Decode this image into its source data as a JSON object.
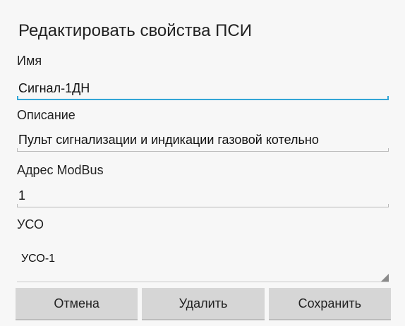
{
  "dialog": {
    "title": "Редактировать свойства ПСИ"
  },
  "fields": {
    "name": {
      "label": "Имя",
      "value": "Сигнал-1ДН"
    },
    "description": {
      "label": "Описание",
      "value": "Пульт сигнализации и индикации газовой котельно"
    },
    "modbus_address": {
      "label": "Адрес ModBus",
      "value": "1"
    },
    "uso": {
      "label": "УСО",
      "selected": "УСО-1"
    }
  },
  "buttons": {
    "cancel": "Отмена",
    "delete": "Удалить",
    "save": "Сохранить"
  },
  "colors": {
    "accent": "#33a6d6",
    "button_bg": "#d6d6d6",
    "background": "#f7f7f7"
  }
}
